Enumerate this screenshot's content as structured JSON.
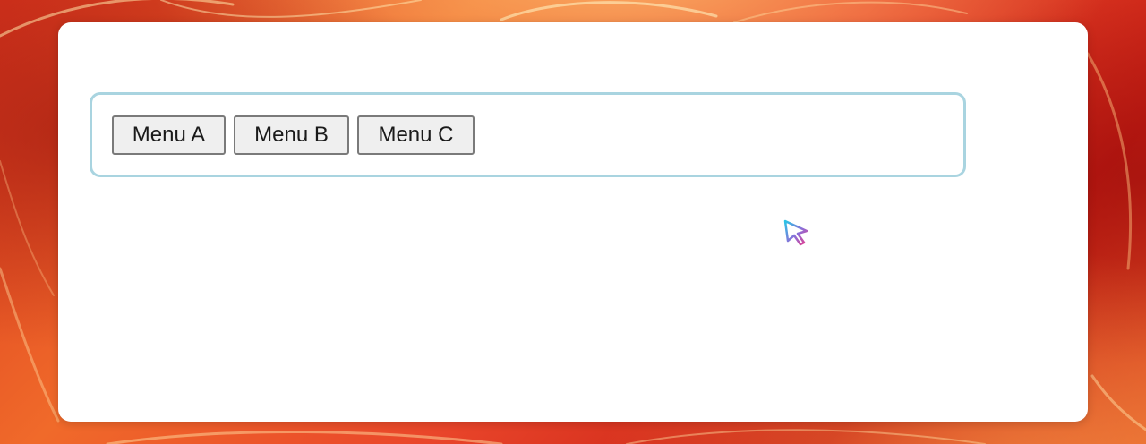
{
  "desktop": {
    "wallpaper": "orange-red swirl"
  },
  "window": {
    "background_color": "#ffffff"
  },
  "menubar": {
    "border_color": "#a9d4e0",
    "items": [
      {
        "label": "Menu A"
      },
      {
        "label": "Menu B"
      },
      {
        "label": "Menu C"
      }
    ]
  },
  "cursor": {
    "icon": "mouse-pointer-icon",
    "colors": [
      "#29c5e6",
      "#e83c8c",
      "#ffffff"
    ]
  }
}
